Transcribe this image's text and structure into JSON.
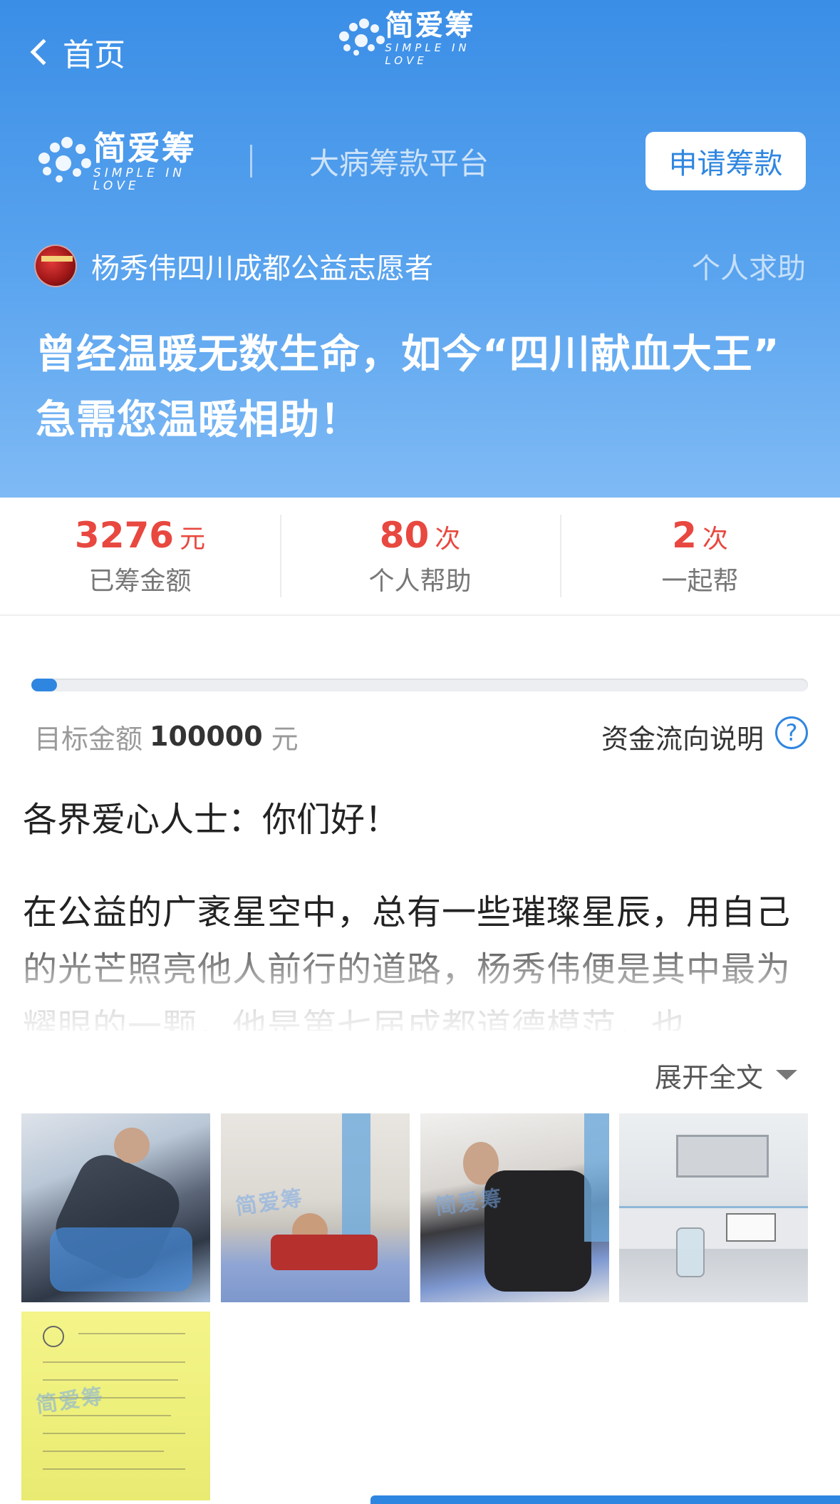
{
  "nav": {
    "back_label": "首页"
  },
  "logo": {
    "cn": "简爱筹",
    "en": "SIMPLE IN LOVE"
  },
  "brand": {
    "tagline": "大病筹款平台",
    "apply_button": "申请筹款"
  },
  "author": {
    "name": "杨秀伟四川成都公益志愿者",
    "tag": "个人求助"
  },
  "campaign": {
    "title": "曾经温暖无数生命，如今“四川献血大王” 急需您温暖相助！"
  },
  "stats": [
    {
      "value": "3276",
      "unit": "元",
      "label": "已筹金额"
    },
    {
      "value": "80",
      "unit": "次",
      "label": "个人帮助"
    },
    {
      "value": "2",
      "unit": "次",
      "label": "一起帮"
    }
  ],
  "progress": {
    "raised": 3276,
    "target": 100000
  },
  "target": {
    "label": "目标金额",
    "amount": "100000",
    "unit": "元",
    "fund_flow_label": "资金流向说明",
    "help_icon": "?"
  },
  "story": {
    "greeting": "各界爱心人士：你们好！",
    "text": "在公益的广袤星空中，总有一些璀璨星辰，用自己的光芒照亮他人前行的道路，杨秀伟便是其中最为耀眼的一颗，他是第七届成都道德模范，也",
    "expand_label": "展开全文"
  },
  "colors": {
    "primary": "#2f86e0",
    "accent": "#e8483f"
  },
  "photos": [
    "photo-1",
    "photo-2",
    "photo-3",
    "photo-4",
    "photo-5"
  ]
}
